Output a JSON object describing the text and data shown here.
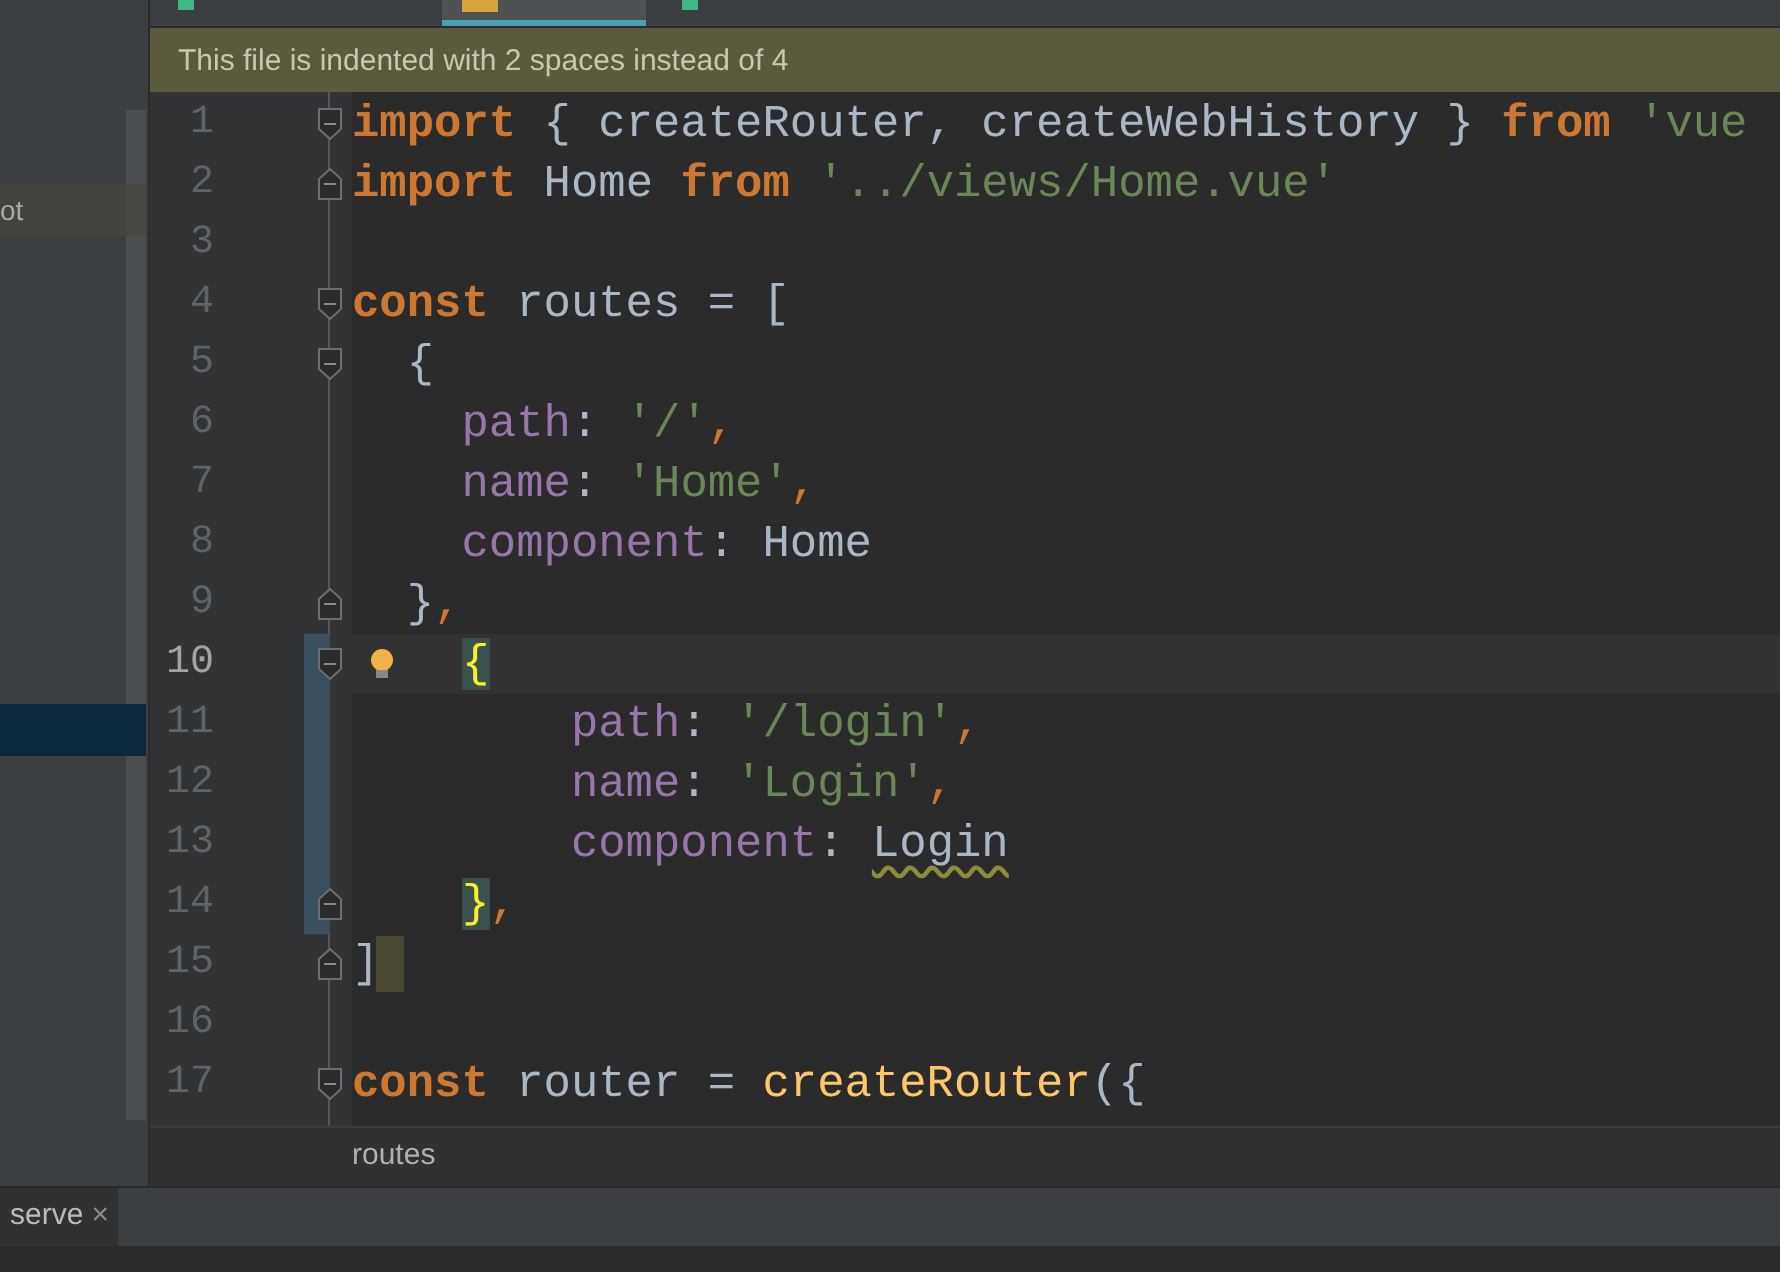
{
  "tabs": [
    {
      "kind": "vue",
      "selected": false
    },
    {
      "kind": "js",
      "selected": true
    },
    {
      "kind": "vue",
      "selected": false
    }
  ],
  "notification": "This file is indented with 2 spaces instead of 4",
  "sidebar": {
    "items": [
      {
        "label": "ot",
        "selected": false
      },
      {
        "selected": true
      }
    ]
  },
  "lines": [
    {
      "number": "1",
      "fold_start": true,
      "tokens": [
        {
          "kind": "kw",
          "text": "import"
        },
        {
          "kind": "id",
          "text": " { createRouter, createWebHistory } "
        },
        {
          "kind": "kw",
          "text": "from"
        },
        {
          "kind": "str",
          "text": " 'vue"
        }
      ]
    },
    {
      "number": "2",
      "fold_end": true,
      "tokens": [
        {
          "kind": "kw",
          "text": "import"
        },
        {
          "kind": "id",
          "text": " Home "
        },
        {
          "kind": "kw",
          "text": "from"
        },
        {
          "kind": "str",
          "text": " '../views/Home.vue'"
        }
      ]
    },
    {
      "number": "3"
    },
    {
      "number": "4",
      "fold_start": true,
      "tokens": [
        {
          "kind": "kw",
          "text": "const"
        },
        {
          "kind": "id",
          "text": " routes = ["
        }
      ]
    },
    {
      "number": "5",
      "fold_start": true,
      "tokens": [
        {
          "kind": "id",
          "text": "  {"
        }
      ]
    },
    {
      "number": "6",
      "tokens": [
        {
          "kind": "prop",
          "text": "    path"
        },
        {
          "kind": "id",
          "text": ": "
        },
        {
          "kind": "str",
          "text": "'/'"
        },
        {
          "kind": "punct",
          "text": ","
        }
      ]
    },
    {
      "number": "7",
      "tokens": [
        {
          "kind": "prop",
          "text": "    name"
        },
        {
          "kind": "id",
          "text": ": "
        },
        {
          "kind": "str",
          "text": "'Home'"
        },
        {
          "kind": "punct",
          "text": ","
        }
      ]
    },
    {
      "number": "8",
      "tokens": [
        {
          "kind": "prop",
          "text": "    component"
        },
        {
          "kind": "id",
          "text": ": Home"
        }
      ]
    },
    {
      "number": "9",
      "fold_end": true,
      "tokens": [
        {
          "kind": "id",
          "text": "  }"
        },
        {
          "kind": "punct",
          "text": ","
        }
      ]
    },
    {
      "number": "10",
      "fold_start": true,
      "current": true,
      "changed": true,
      "intention": true,
      "tokens": [
        {
          "kind": "match",
          "text": "{"
        }
      ]
    },
    {
      "number": "11",
      "changed": true,
      "tokens": [
        {
          "kind": "prop",
          "text": "        path"
        },
        {
          "kind": "id",
          "text": ": "
        },
        {
          "kind": "str",
          "text": "'/login'"
        },
        {
          "kind": "punct",
          "text": ","
        }
      ]
    },
    {
      "number": "12",
      "changed": true,
      "tokens": [
        {
          "kind": "prop",
          "text": "        name"
        },
        {
          "kind": "id",
          "text": ": "
        },
        {
          "kind": "str",
          "text": "'Login'"
        },
        {
          "kind": "punct",
          "text": ","
        }
      ]
    },
    {
      "number": "13",
      "changed": true,
      "tokens": [
        {
          "kind": "prop",
          "text": "        component"
        },
        {
          "kind": "id",
          "text": ": "
        },
        {
          "kind": "typo",
          "text": "Login"
        }
      ]
    },
    {
      "number": "14",
      "fold_end": true,
      "changed": true,
      "tokens": [
        {
          "kind": "match",
          "text": "}"
        },
        {
          "kind": "punct",
          "text": ","
        }
      ]
    },
    {
      "number": "15",
      "fold_end": true,
      "caret_mark": true,
      "tokens": [
        {
          "kind": "id",
          "text": "]"
        }
      ]
    },
    {
      "number": "16"
    },
    {
      "number": "17",
      "fold_start": true,
      "tokens": [
        {
          "kind": "kw",
          "text": "const"
        },
        {
          "kind": "id",
          "text": " router = "
        },
        {
          "kind": "fn",
          "text": "createRouter"
        },
        {
          "kind": "id",
          "text": "({"
        }
      ]
    }
  ],
  "breadcrumb": "routes",
  "tool_tab": {
    "label": "serve",
    "close": "×"
  }
}
